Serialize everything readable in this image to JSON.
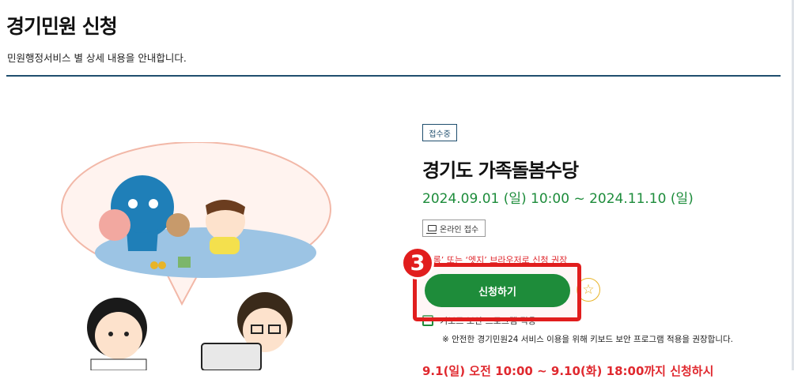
{
  "header": {
    "title": "경기민원 신청",
    "description": "민원행정서비스 별 상세 내용을 안내합니다."
  },
  "service": {
    "status_badge": "접수중",
    "title": "경기도 가족돌봄수당",
    "period": "2024.09.01 (일) 10:00 ~ 2024.11.10 (일)",
    "online_badge": "온라인 접수",
    "browser_note": "‘크롬’ 또는 ‘엣지’ 브라우저로 신청 권장",
    "apply_label": "신청하기",
    "keyboard_label": "키보드 보안 프로그램 적용",
    "keyboard_notice": "※ 안전한 경기민원24 서비스 이용을 위해 키보드 보안 프로그램 적용을 권장합니다.",
    "bottom_line": "9.1(일) 오전 10:00 ~ 9.10(화) 18:00까지 신청하시"
  },
  "annotation": {
    "step_number": "3"
  },
  "icons": {
    "online": "monitor-icon",
    "favorite": "star-icon"
  },
  "colors": {
    "accent_green": "#1e8c3a",
    "highlight_red": "#e11d1d",
    "navy": "#1f4e6e"
  }
}
